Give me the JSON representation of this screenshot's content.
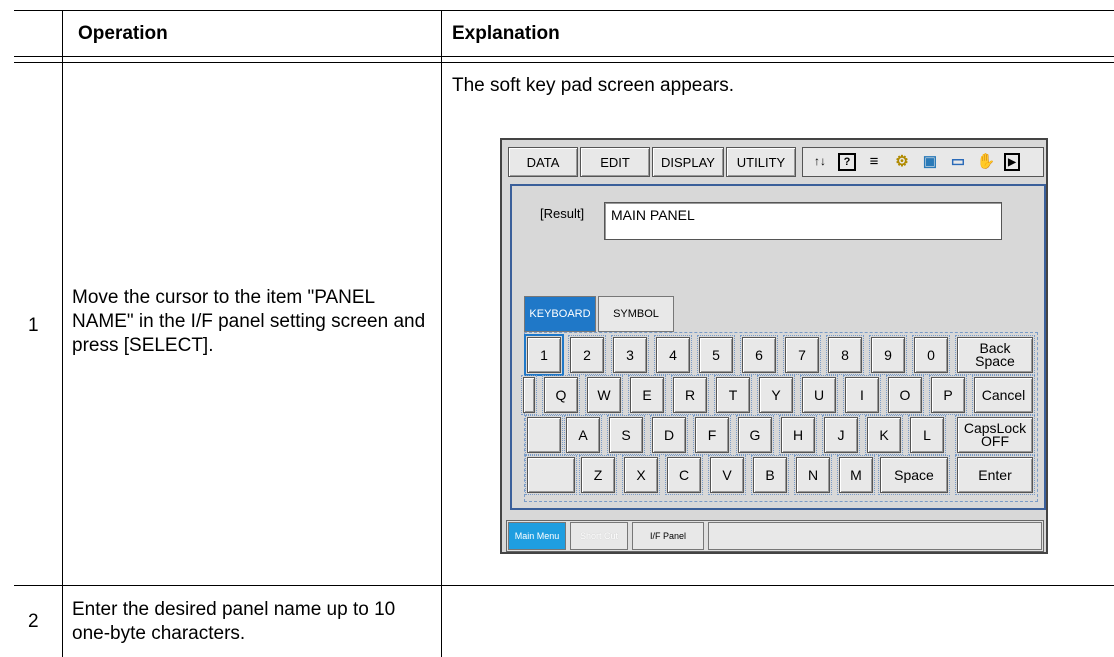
{
  "table": {
    "headers": {
      "operation": "Operation",
      "explanation": "Explanation"
    },
    "rows": [
      {
        "num": "1",
        "operation": "Move the cursor to the item \"PANEL NAME\" in the I/F panel setting screen and press [SELECT].",
        "explanation": "The soft key pad screen appears."
      },
      {
        "num": "2",
        "operation": "Enter the desired panel name up to 10 one-byte characters.",
        "explanation": ""
      }
    ]
  },
  "pendant": {
    "menu": [
      "DATA",
      "EDIT",
      "DISPLAY",
      "UTILITY"
    ],
    "icons": [
      "io-icon",
      "help-icon",
      "chart-icon",
      "robot-icon",
      "tc-icon",
      "screen-icon",
      "hand-icon",
      "play-icon"
    ],
    "icon_glyphs": [
      "↑↓",
      "?",
      "≡",
      "⚙",
      "▣",
      "▭",
      "✋",
      "▶"
    ],
    "result_label": "[Result]",
    "result_value": "MAIN PANEL",
    "tabs": {
      "keyboard": "KEYBOARD",
      "symbol": "SYMBOL"
    },
    "rows": {
      "r1": [
        "1",
        "2",
        "3",
        "4",
        "5",
        "6",
        "7",
        "8",
        "9",
        "0",
        "Back Space"
      ],
      "r2": [
        "Q",
        "W",
        "E",
        "R",
        "T",
        "Y",
        "U",
        "I",
        "O",
        "P",
        "Cancel"
      ],
      "r3": [
        "A",
        "S",
        "D",
        "F",
        "G",
        "H",
        "J",
        "K",
        "L",
        "CapsLock OFF"
      ],
      "r4": [
        "Z",
        "X",
        "C",
        "V",
        "B",
        "N",
        "M",
        "Space",
        "Enter"
      ]
    },
    "bottom": {
      "main_menu": "Main Menu",
      "short_cut": "Short Cut",
      "if_panel": "I/F Panel"
    },
    "colors": {
      "accent": "#1f78c8",
      "frame": "#3a5f9a",
      "bg": "#d8d8d8"
    }
  }
}
